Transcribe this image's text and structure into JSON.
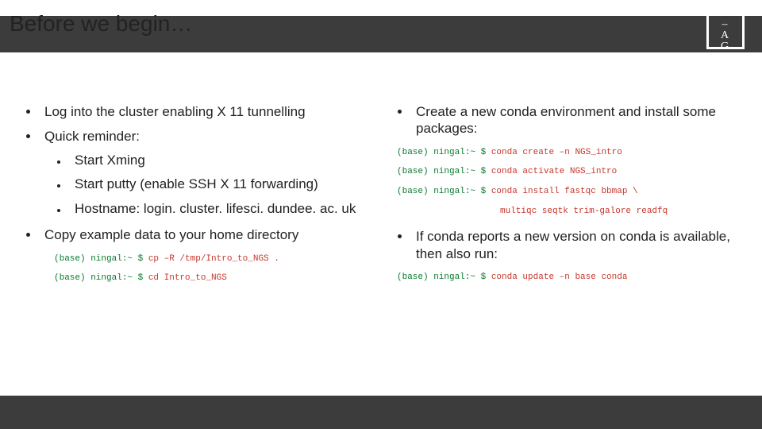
{
  "title": "Before we begin…",
  "logo": {
    "row1": "D –",
    "row2": "– A",
    "row3": "G –"
  },
  "left": {
    "b1": [
      "Log into the cluster enabling X 11 tunnelling",
      "Quick reminder:"
    ],
    "b2": [
      "Start Xming",
      "Start putty (enable SSH X 11 forwarding)",
      "Hostname: login. cluster. lifesci. dundee. ac. uk"
    ],
    "b3": "Copy example data to your home directory",
    "term1_prompt": "(base) ningal:~ $ ",
    "term1_cmd": "cp –R /tmp/Intro_to_NGS .",
    "term2_prompt": "(base) ningal:~ $ ",
    "term2_cmd": "cd Intro_to_NGS"
  },
  "right": {
    "b1": "Create a new conda environment and install some packages:",
    "t1_prompt": "(base) ningal:~ $ ",
    "t1_cmd": "conda create –n NGS_intro",
    "t2_prompt": "(base) ningal:~ $ ",
    "t2_cmd": "conda activate NGS_intro",
    "t3_prompt": "(base) ningal:~ $ ",
    "t3_cmd": "conda install fastqc bbmap \\",
    "t4_cmd": "multiqc seqtk trim-galore readfq",
    "b2": "If conda reports a new version on conda is available, then also run:",
    "t5_prompt": "(base) ningal:~ $ ",
    "t5_cmd": "conda update –n base conda"
  }
}
